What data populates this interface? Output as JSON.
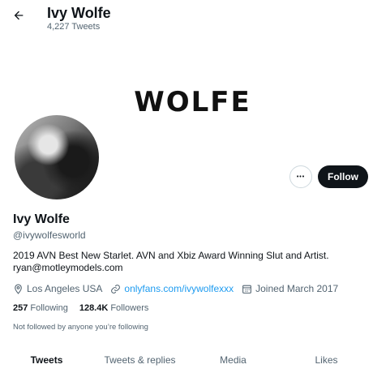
{
  "header": {
    "title": "Ivy Wolfe",
    "subtitle": "4,227 Tweets"
  },
  "banner": {
    "text": "WOLFE"
  },
  "actions": {
    "more_label": "•••",
    "follow_label": "Follow"
  },
  "profile": {
    "name": "Ivy Wolfe",
    "handle": "@ivywolfesworld",
    "bio_line1": "2019 AVN Best New Starlet. AVN and Xbiz Award Winning Slut and Artist.",
    "bio_line2": "ryan@motleymodels.com",
    "location": "Los Angeles USA",
    "website": "onlyfans.com/ivywolfexxx",
    "joined": "Joined March 2017"
  },
  "stats": {
    "following_count": "257",
    "following_label": "Following",
    "followers_count": "128.4K",
    "followers_label": "Followers"
  },
  "not_followed_text": "Not followed by anyone you’re following",
  "tabs": [
    {
      "label": "Tweets"
    },
    {
      "label": "Tweets & replies"
    },
    {
      "label": "Media"
    },
    {
      "label": "Likes"
    }
  ],
  "icons": {
    "back": "arrow-left-icon",
    "location": "location-pin-icon",
    "link": "link-icon",
    "calendar": "calendar-icon",
    "more": "more-horizontal-icon"
  },
  "colors": {
    "accent": "#1d9bf0",
    "text": "#0f1419",
    "secondary": "#536471",
    "follow_bg": "#0f1419"
  }
}
